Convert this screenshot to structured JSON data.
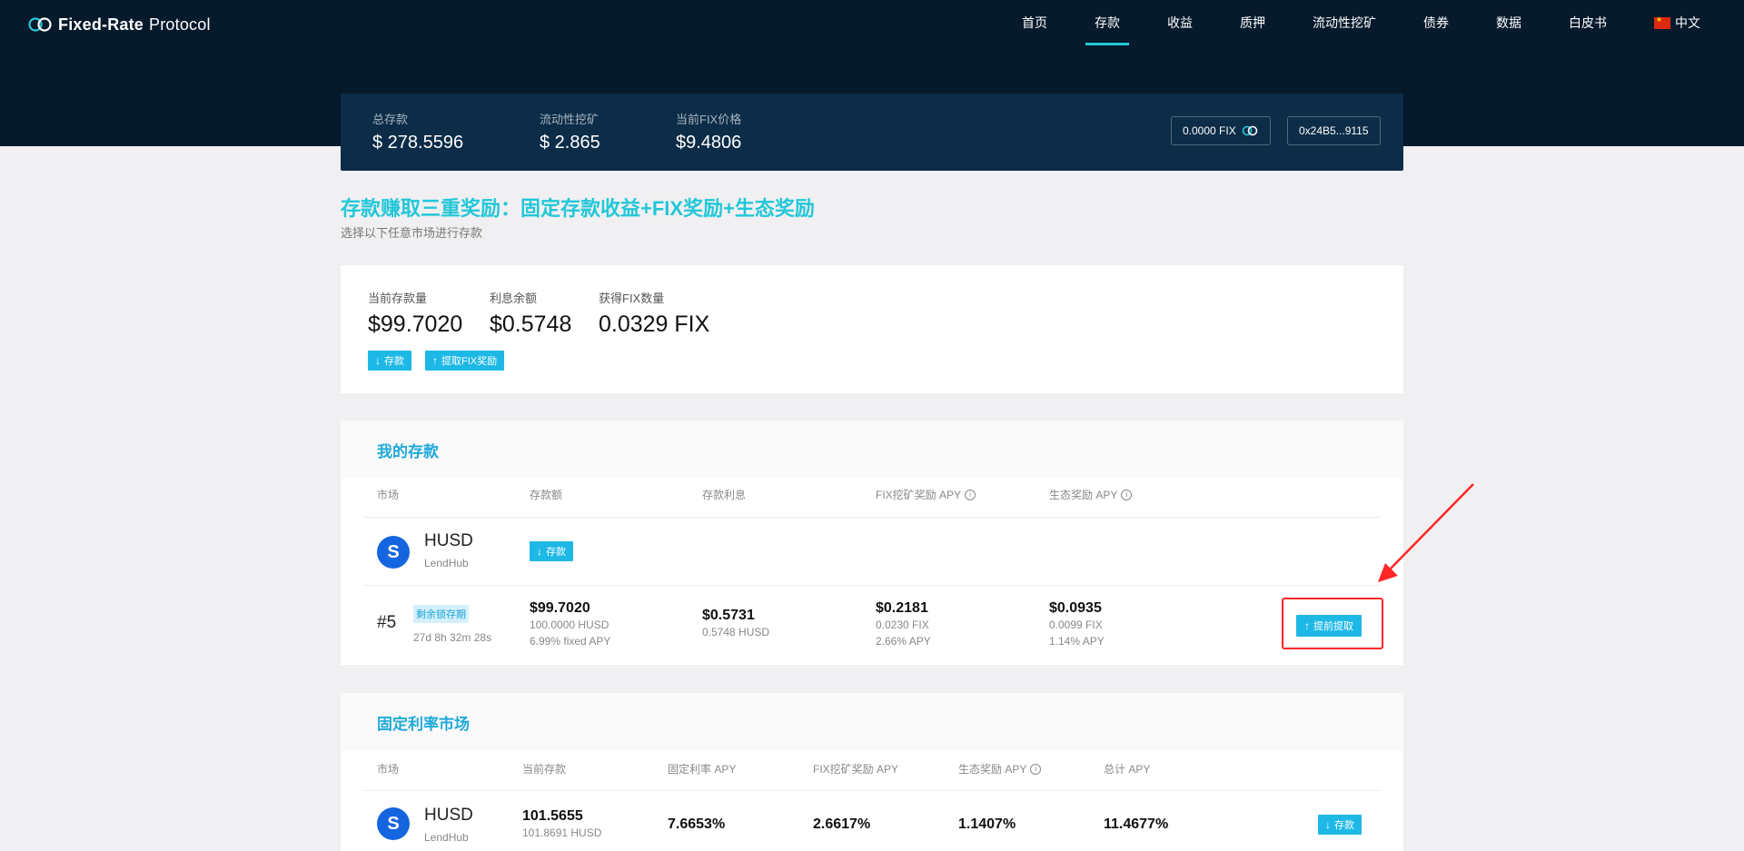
{
  "header": {
    "logo_text_bold": "Fixed-Rate",
    "logo_text_regular": "Protocol",
    "nav": [
      "首页",
      "存款",
      "收益",
      "质押",
      "流动性挖矿",
      "债券",
      "数据",
      "白皮书"
    ],
    "active_nav": "存款",
    "language": "中文"
  },
  "stats": {
    "total_deposit_label": "总存款",
    "total_deposit_value": "$ 278.5596",
    "liquidity_label": "流动性挖矿",
    "liquidity_value": "$ 2.865",
    "fix_price_label": "当前FIX价格",
    "fix_price_value": "$9.4806",
    "fix_balance": "0.0000 FIX",
    "wallet": "0x24B5...9115"
  },
  "headline": {
    "title": "存款赚取三重奖励：固定存款收益+FIX奖励+生态奖励",
    "subtitle": "选择以下任意市场进行存款"
  },
  "summary": {
    "current_deposit_label": "当前存款量",
    "current_deposit_value": "$99.7020",
    "interest_label": "利息余额",
    "interest_value": "$0.5748",
    "fix_earned_label": "获得FIX数量",
    "fix_earned_value": "0.0329 FIX",
    "deposit_btn": "存款",
    "withdraw_fix_btn": "提取FIX奖励"
  },
  "my_deposits": {
    "title": "我的存款",
    "columns": [
      "市场",
      "存款额",
      "存款利息",
      "FIX挖矿奖励 APY",
      "生态奖励 APY"
    ],
    "market": {
      "name": "HUSD",
      "provider": "LendHub",
      "deposit_btn": "存款"
    },
    "position": {
      "id": "#5",
      "lock_tag": "剩余锁存期",
      "lock_time": "27d 8h 32m 28s",
      "amount_main": "$99.7020",
      "amount_sub1": "100.0000 HUSD",
      "amount_sub2": "6.99% fixed APY",
      "interest_main": "$0.5731",
      "interest_sub1": "0.5748 HUSD",
      "fix_main": "$0.2181",
      "fix_sub1": "0.0230 FIX",
      "fix_sub2": "2.66% APY",
      "eco_main": "$0.0935",
      "eco_sub1": "0.0099 FIX",
      "eco_sub2": "1.14% APY",
      "early_withdraw_btn": "提前提取"
    }
  },
  "fixed_market": {
    "title": "固定利率市场",
    "columns": [
      "市场",
      "当前存款",
      "固定利率 APY",
      "FIX挖矿奖励 APY",
      "生态奖励 APY",
      "总计 APY"
    ],
    "row": {
      "name": "HUSD",
      "provider": "LendHub",
      "current_main": "101.5655",
      "current_sub": "101.8691 HUSD",
      "fixed_rate": "7.6653%",
      "fix_apy": "2.6617%",
      "eco_apy": "1.1407%",
      "total_apy": "11.4677%",
      "deposit_btn": "存款"
    }
  },
  "colors": {
    "accent": "#1eb8e6",
    "header_bg": "#061a2c",
    "highlight": "#ff2626"
  }
}
